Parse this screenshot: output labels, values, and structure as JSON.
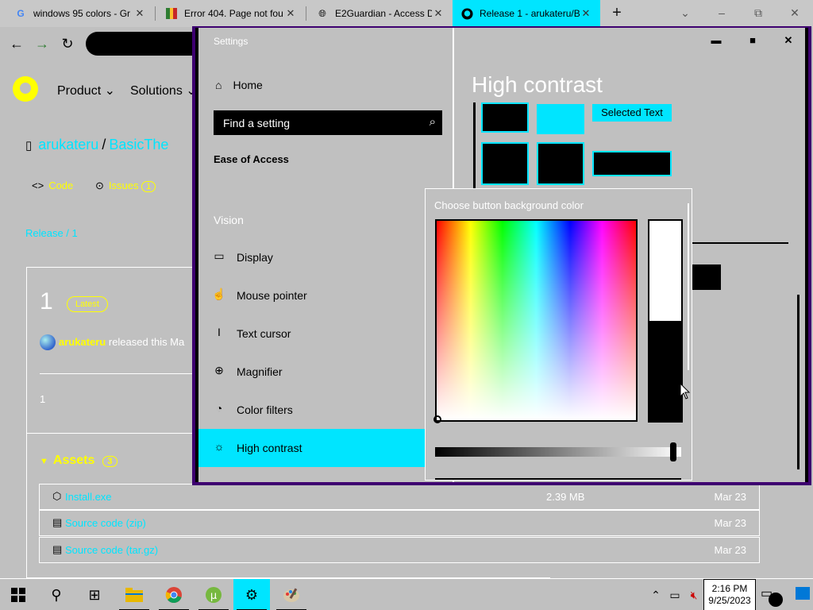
{
  "browser": {
    "tabs": [
      {
        "title": "windows 95 colors - Gr",
        "icon": "google-icon"
      },
      {
        "title": "Error 404. Page not fou",
        "icon": "colorbar-icon"
      },
      {
        "title": "E2Guardian - Access D",
        "icon": "globe-icon"
      },
      {
        "title": "Release 1 - arukateru/B",
        "icon": "github-icon",
        "active": true
      }
    ],
    "new_tab": "+",
    "win_controls": [
      "‒",
      "⧉",
      "✕"
    ],
    "chevron": "⌄"
  },
  "github": {
    "nav": [
      "Product ⌄",
      "Solutions ⌄"
    ],
    "repo_owner": "arukateru",
    "repo_slash": "/",
    "repo_name": "BasicThe",
    "tabs": {
      "code": "Code",
      "issues": "Issues",
      "issues_count": "1"
    },
    "breadcrumb": "Release / 1",
    "release": {
      "number": "1",
      "latest": "Latest",
      "author": "arukateru",
      "released_text": " released this Ma",
      "body": "1"
    },
    "assets": {
      "heading": "Assets",
      "count": "3",
      "rows": [
        {
          "name": "Install.exe",
          "size": "2.39 MB",
          "date": "Mar 23"
        },
        {
          "name": "Source code (zip)",
          "size": "",
          "date": "Mar 23"
        },
        {
          "name": "Source code (tar.gz)",
          "size": "",
          "date": "Mar 23"
        }
      ]
    }
  },
  "settings": {
    "window_title": "Settings",
    "home": "Home",
    "search_placeholder": "Find a setting",
    "category": "Ease of Access",
    "group": "Vision",
    "items": [
      {
        "label": "Display",
        "icon": "monitor-icon"
      },
      {
        "label": "Mouse pointer",
        "icon": "pointer-icon"
      },
      {
        "label": "Text cursor",
        "icon": "text-cursor-icon"
      },
      {
        "label": "Magnifier",
        "icon": "magnifier-icon"
      },
      {
        "label": "Color filters",
        "icon": "palette-icon"
      },
      {
        "label": "High contrast",
        "icon": "sun-icon",
        "selected": true
      }
    ],
    "page_title": "High contrast",
    "selected_text": "Selected Text",
    "controls": {
      "minimize": "▬",
      "maximize": "■",
      "close": "✕"
    }
  },
  "color_picker": {
    "title": "Choose button background color",
    "value_level": 0.98
  },
  "taskbar": {
    "time": "2:16 PM",
    "date": "9/25/2023",
    "apps": [
      "windows-icon",
      "search-icon",
      "task-view-icon",
      "file-explorer-icon",
      "chrome-icon",
      "utorrent-icon",
      "settings-icon",
      "paint-icon"
    ]
  },
  "colors": {
    "background": "#c0c0c0",
    "accent_cyan": "#00e5ff",
    "accent_yellow": "#ffff00",
    "window_border": "#3d0070"
  }
}
